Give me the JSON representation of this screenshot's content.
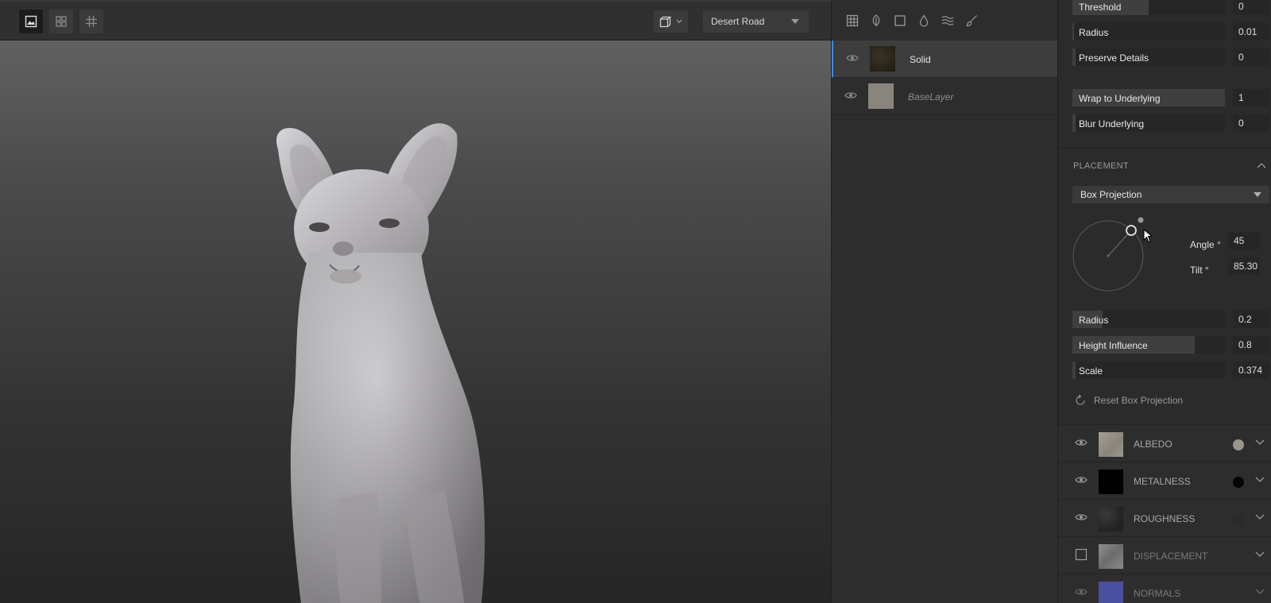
{
  "toolbar": {
    "environment": "Desert Road",
    "view_buttons": [
      "image-view-icon",
      "grid-2x2-icon",
      "grid-3x3-icon"
    ]
  },
  "layers": {
    "tools": [
      "grid-icon",
      "leaf-icon",
      "square-icon",
      "drop-icon",
      "waves-icon",
      "brush-icon"
    ],
    "items": [
      {
        "name": "Solid",
        "selected": true
      },
      {
        "name": "BaseLayer",
        "selected": false
      }
    ]
  },
  "props": {
    "top_sliders": [
      {
        "label": "Threshold",
        "value": "0"
      },
      {
        "label": "Radius",
        "value": "0.01"
      },
      {
        "label": "Preserve Details",
        "value": "0"
      },
      {
        "label": "Wrap to Underlying",
        "value": "1"
      },
      {
        "label": "Blur Underlying",
        "value": "0"
      }
    ],
    "placement": {
      "title": "PLACEMENT",
      "projection": "Box Projection",
      "angle_label": "Angle °",
      "angle_value": "45",
      "tilt_label": "Tilt °",
      "tilt_value": "85.30",
      "sliders": [
        {
          "label": "Radius",
          "value": "0.2"
        },
        {
          "label": "Height Influence",
          "value": "0.8"
        },
        {
          "label": "Scale",
          "value": "0.374"
        }
      ],
      "reset_label": "Reset Box Projection"
    },
    "channels": [
      {
        "name": "ALBEDO",
        "dot_color": "#9a958c",
        "visible": true
      },
      {
        "name": "METALNESS",
        "dot_color": "#050505",
        "visible": true
      },
      {
        "name": "ROUGHNESS",
        "dot_color": "#2a2a2a",
        "visible": true
      },
      {
        "name": "DISPLACEMENT",
        "dot_color": "",
        "visible": false
      },
      {
        "name": "NORMALS",
        "dot_color": "",
        "visible": true
      }
    ]
  },
  "colors": {
    "accent": "#3a8ee0",
    "panel": "#2b2b2b",
    "field": "#262626"
  }
}
